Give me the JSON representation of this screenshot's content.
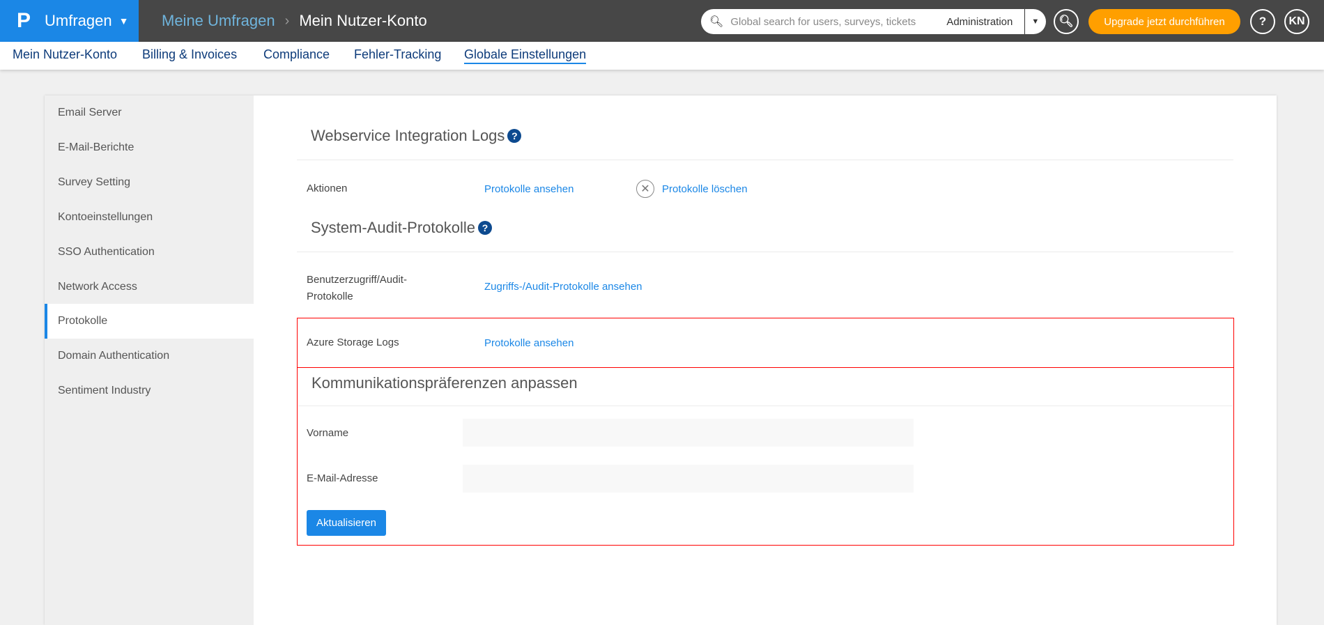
{
  "header": {
    "logo": "P",
    "app": "Umfragen",
    "breadcrumb": [
      "Meine Umfragen",
      "Mein Nutzer-Konto"
    ],
    "search_placeholder": "Global search for users, surveys, tickets",
    "search_scope": "Administration",
    "upgrade": "Upgrade jetzt durchführen",
    "help": "?",
    "avatar": "KN"
  },
  "nav": [
    "Mein Nutzer-Konto",
    "Billing & Invoices",
    "Compliance",
    "Fehler-Tracking",
    "Globale Einstellungen"
  ],
  "sidebar": [
    "Email Server",
    "E-Mail-Berichte",
    "Survey Setting",
    "Kontoeinstellungen",
    "SSO Authentication",
    "Network Access",
    "Protokolle",
    "Domain Authentication",
    "Sentiment Industry"
  ],
  "webservice": {
    "title": "Webservice Integration Logs",
    "label": "Aktionen",
    "view": "Protokolle ansehen",
    "delete": "Protokolle löschen"
  },
  "audit": {
    "title": "System-Audit-Protokolle",
    "label_line1": "Benutzerzugriff/Audit-",
    "label_line2": "Protokolle",
    "view": "Zugriffs-/Audit-Protokolle ansehen"
  },
  "azure": {
    "label": "Azure Storage Logs",
    "view": "Protokolle ansehen"
  },
  "comm": {
    "title": "Kommunikationspräferenzen anpassen",
    "first_name": "Vorname",
    "email": "E-Mail-Adresse",
    "first_name_value": "",
    "email_value": "",
    "submit": "Aktualisieren"
  },
  "colors": {
    "primary": "#1b87e6",
    "upgrade": "#ff9f00",
    "topbar": "#474747",
    "highlight": "#ff0000"
  }
}
